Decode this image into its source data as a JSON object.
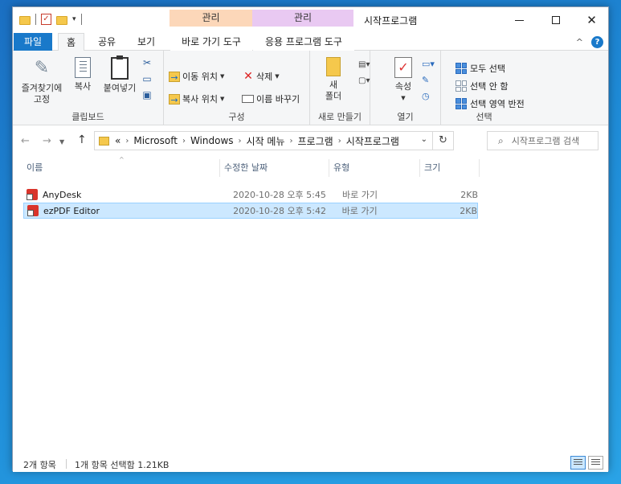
{
  "window": {
    "title": "시작프로그램",
    "minimize_icon": "minimize-icon",
    "maximize_icon": "maximize-icon",
    "close_glyph": "✕"
  },
  "context_tabs": [
    {
      "header": "관리",
      "tab": "바로 가기 도구",
      "color": "#fcd7b9"
    },
    {
      "header": "관리",
      "tab": "응용 프로그램 도구",
      "color": "#e9c9f2"
    }
  ],
  "ribbon_tabs": {
    "file": "파일",
    "home": "홈",
    "share": "공유",
    "view": "보기"
  },
  "ribbon": {
    "clipboard": {
      "label": "클립보드",
      "pin": "즐겨찾기에\n고정",
      "pin_line1": "즐겨찾기에",
      "pin_line2": "고정",
      "copy": "복사",
      "paste": "붙여넣기"
    },
    "organize": {
      "label": "구성",
      "move_to": "이동 위치",
      "copy_to": "복사 위치",
      "delete": "삭제",
      "rename": "이름 바꾸기"
    },
    "new": {
      "label": "새로 만들기",
      "folder_line1": "새",
      "folder_line2": "폴더"
    },
    "open": {
      "label": "열기",
      "properties": "속성"
    },
    "select": {
      "label": "선택",
      "select_all": "모두 선택",
      "select_none": "선택 안 함",
      "invert": "선택 영역 반전"
    }
  },
  "address": {
    "overflow": "«",
    "crumbs": [
      "Microsoft",
      "Windows",
      "시작 메뉴",
      "프로그램",
      "시작프로그램"
    ],
    "search_placeholder": "시작프로그램 검색"
  },
  "columns": {
    "name": "이름",
    "date": "수정한 날짜",
    "type": "유형",
    "size": "크기"
  },
  "files": [
    {
      "name": "AnyDesk",
      "date": "2020-10-28 오후 5:45",
      "type": "바로 가기",
      "size": "2KB",
      "selected": false
    },
    {
      "name": "ezPDF Editor",
      "date": "2020-10-28 오후 5:42",
      "type": "바로 가기",
      "size": "2KB",
      "selected": true
    }
  ],
  "status": {
    "count": "2개 항목",
    "selection": "1개 항목 선택함 1.21KB"
  },
  "colors": {
    "accent": "#1979ca",
    "selection_bg": "#cce8ff",
    "selection_border": "#99d1ff"
  }
}
